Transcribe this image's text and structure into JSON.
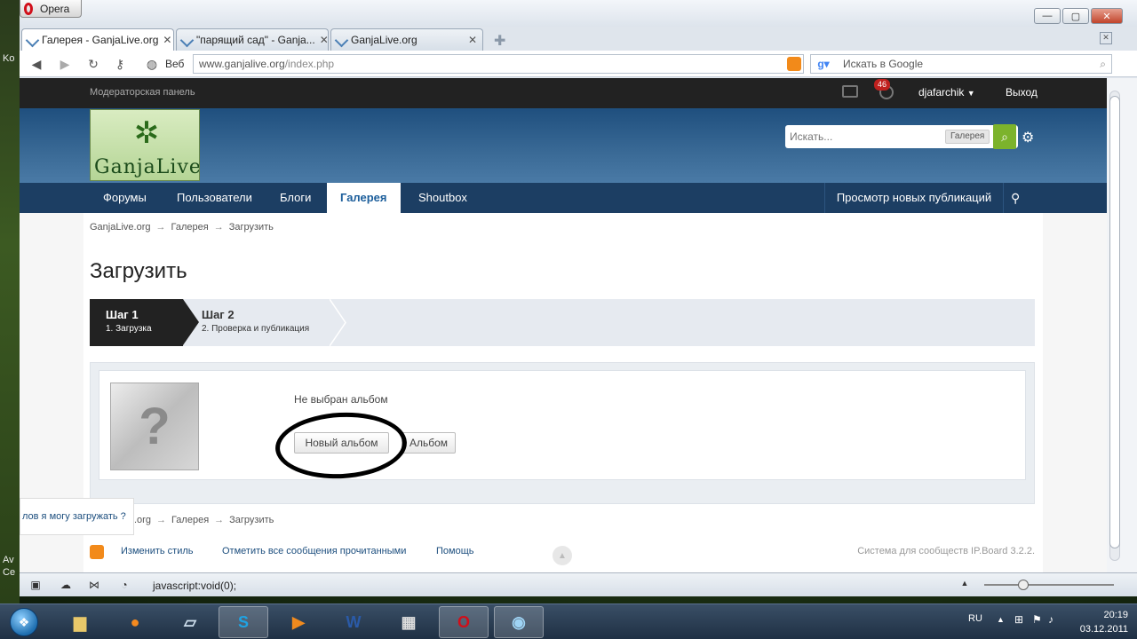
{
  "desktop": {
    "left_labels": [
      "Ko",
      "Av",
      "Ce"
    ]
  },
  "browser": {
    "menu_label": "Opera",
    "tabs": [
      {
        "label": "Галерея - GanjaLive.org"
      },
      {
        "label": "\"парящий сад\" - Ganja..."
      },
      {
        "label": "GanjaLive.org"
      }
    ],
    "tab_close": "✕",
    "address_prefix": "Веб",
    "address_host": "www.ganjalive.org",
    "address_path": "/index.php",
    "search_placeholder": "Искать в Google",
    "window_buttons": {
      "min": "—",
      "max": "▢",
      "close": "✕"
    },
    "status_text": "javascript:void(0);"
  },
  "site": {
    "topbar": {
      "mod_panel": "Модераторская панель",
      "notif_count": "46",
      "username": "djafarchik",
      "username_caret": "▼",
      "logout": "Выход"
    },
    "logo_text": "GanjaLive",
    "search": {
      "placeholder": "Искать...",
      "scope": "Галерея"
    },
    "nav": [
      {
        "label": "Форумы"
      },
      {
        "label": "Пользователи"
      },
      {
        "label": "Блоги"
      },
      {
        "label": "Галерея",
        "active": true
      },
      {
        "label": "Shoutbox"
      }
    ],
    "nav_right": "Просмотр новых публикаций",
    "breadcrumb": [
      "GanjaLive.org",
      "Галерея",
      "Загрузить"
    ],
    "breadcrumb_arrow": "→",
    "title": "Загрузить",
    "steps": [
      {
        "title": "Шаг 1",
        "subtitle": "1. Загрузка"
      },
      {
        "title": "Шаг 2",
        "subtitle": "2. Проверка и публикация"
      }
    ],
    "no_album": "Не выбран альбом",
    "btn_new_album": "Новый альбом",
    "btn_album": "Альбом",
    "help_popup": "лов я могу загружать ?",
    "breadcrumb_bottom_first": ".org",
    "footer": {
      "change_style": "Изменить стиль",
      "mark_read": "Отметить все сообщения прочитанными",
      "help": "Помощь",
      "powered": "Система для сообществ IP.Board 3.2.2."
    }
  },
  "taskbar": {
    "lang": "RU",
    "time": "20:19",
    "date": "03.12.2011"
  }
}
